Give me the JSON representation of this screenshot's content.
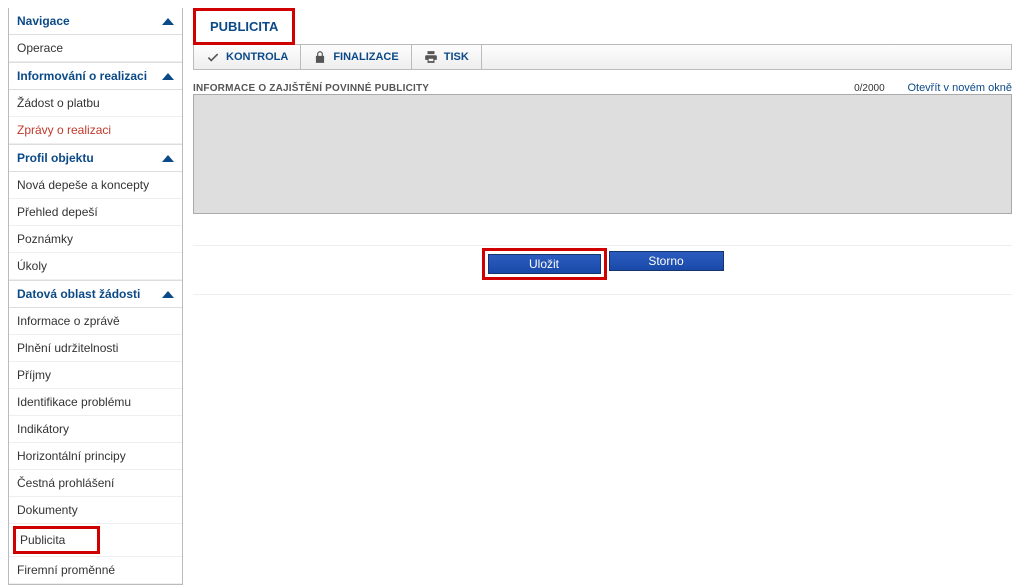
{
  "sidebar": {
    "sections": {
      "navigace": {
        "label": "Navigace",
        "items": [
          {
            "label": "Operace",
            "active": false
          }
        ]
      },
      "informovani": {
        "label": "Informování o realizaci",
        "items": [
          {
            "label": "Žádost o platbu",
            "active": false
          },
          {
            "label": "Zprávy o realizaci",
            "active": true
          }
        ]
      },
      "profil": {
        "label": "Profil objektu",
        "items": [
          {
            "label": "Nová depeše a koncepty",
            "active": false
          },
          {
            "label": "Přehled depeší",
            "active": false
          },
          {
            "label": "Poznámky",
            "active": false
          },
          {
            "label": "Úkoly",
            "active": false
          }
        ]
      },
      "datova": {
        "label": "Datová oblast žádosti",
        "items": [
          {
            "label": "Informace o zprávě",
            "active": false
          },
          {
            "label": "Plnění udržitelnosti",
            "active": false
          },
          {
            "label": "Příjmy",
            "active": false
          },
          {
            "label": "Identifikace problému",
            "active": false
          },
          {
            "label": "Indikátory",
            "active": false
          },
          {
            "label": "Horizontální principy",
            "active": false
          },
          {
            "label": "Čestná prohlášení",
            "active": false
          },
          {
            "label": "Dokumenty",
            "active": false
          },
          {
            "label": "Publicita",
            "active": true,
            "highlight": true
          },
          {
            "label": "Firemní proměnné",
            "active": false
          }
        ]
      }
    }
  },
  "main": {
    "page_title": "PUBLICITA",
    "toolbar": {
      "kontrola": "KONTROLA",
      "finalizace": "FINALIZACE",
      "tisk": "TISK"
    },
    "info_label": "INFORMACE O ZAJIŠTĚNÍ POVINNÉ PUBLICITY",
    "counter": "0/2000",
    "open_new": "Otevřít v novém okně",
    "textarea_value": "",
    "buttons": {
      "save": "Uložit",
      "cancel": "Storno"
    }
  }
}
